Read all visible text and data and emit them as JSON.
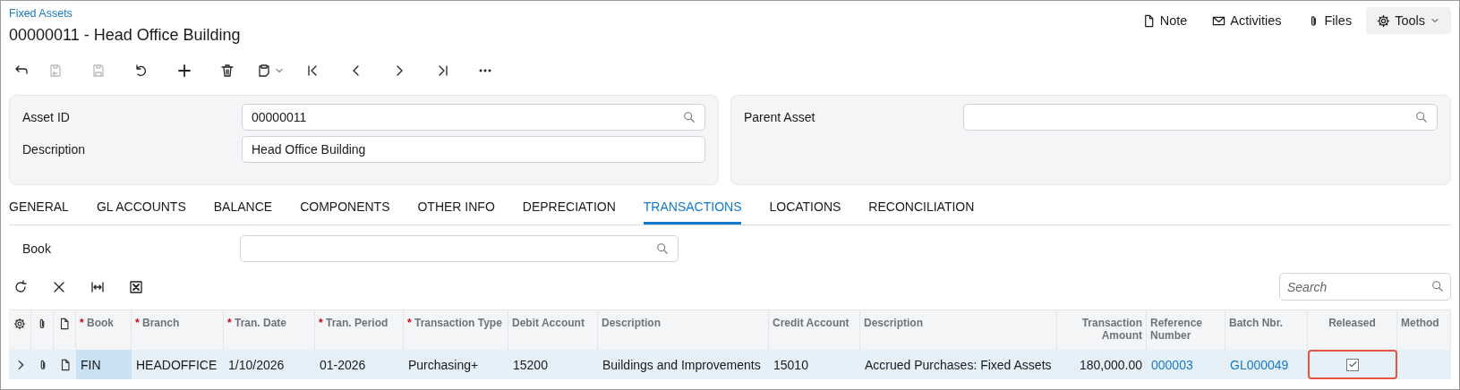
{
  "breadcrumb": "Fixed Assets",
  "title": "00000011 - Head Office Building",
  "header_actions": [
    {
      "kind": "note",
      "label": "Note"
    },
    {
      "kind": "activities",
      "label": "Activities"
    },
    {
      "kind": "files",
      "label": "Files"
    },
    {
      "kind": "tools",
      "label": "Tools"
    }
  ],
  "toolbar": [
    {
      "kind": "back",
      "disabled": false
    },
    {
      "kind": "save-close",
      "disabled": true
    },
    {
      "kind": "save",
      "disabled": true
    },
    {
      "kind": "undo",
      "disabled": false
    },
    {
      "kind": "add",
      "disabled": false
    },
    {
      "kind": "delete",
      "disabled": false
    },
    {
      "kind": "clipboard",
      "disabled": false
    },
    {
      "kind": "first",
      "disabled": false
    },
    {
      "kind": "prev",
      "disabled": false
    },
    {
      "kind": "next",
      "disabled": false
    },
    {
      "kind": "last",
      "disabled": false
    },
    {
      "kind": "more",
      "disabled": false
    }
  ],
  "form_left": [
    {
      "label": "Asset ID",
      "value": "00000011",
      "kind": "lookup"
    },
    {
      "label": "Description",
      "value": "Head Office Building",
      "kind": "text"
    }
  ],
  "form_right": [
    {
      "label": "Parent Asset",
      "kind": "lookup"
    }
  ],
  "tabs": [
    {
      "label": "GENERAL",
      "selected": false
    },
    {
      "label": "GL ACCOUNTS",
      "selected": false
    },
    {
      "label": "BALANCE",
      "selected": false
    },
    {
      "label": "COMPONENTS",
      "selected": false
    },
    {
      "label": "OTHER INFO",
      "selected": false
    },
    {
      "label": "DEPRECIATION",
      "selected": false
    },
    {
      "label": "TRANSACTIONS",
      "selected": true
    },
    {
      "label": "LOCATIONS",
      "selected": false
    },
    {
      "label": "RECONCILIATION",
      "selected": false
    }
  ],
  "book_filter": {
    "label": "Book"
  },
  "grid_toolbar": [
    {
      "kind": "refresh"
    },
    {
      "kind": "cancel"
    },
    {
      "kind": "fit"
    },
    {
      "kind": "excel"
    }
  ],
  "grid_search": {
    "placeholder": "Search"
  },
  "table": {
    "required_mark": "*",
    "columns": [
      {
        "label": "Book",
        "required": true,
        "kind": "text"
      },
      {
        "label": "Branch",
        "required": true,
        "kind": "text"
      },
      {
        "label": "Tran. Date",
        "required": true,
        "kind": "text"
      },
      {
        "label": "Tran. Period",
        "required": true,
        "kind": "text"
      },
      {
        "label": "Transaction Type",
        "required": true,
        "kind": "text"
      },
      {
        "label": "Debit Account",
        "required": false,
        "kind": "text"
      },
      {
        "label": "Description",
        "required": false,
        "kind": "text"
      },
      {
        "label": "Credit Account",
        "required": false,
        "kind": "text"
      },
      {
        "label": "Description",
        "required": false,
        "kind": "text"
      },
      {
        "label": "Transaction Amount",
        "required": false,
        "kind": "amount"
      },
      {
        "label": "Reference Number",
        "required": false,
        "kind": "link"
      },
      {
        "label": "Batch Nbr.",
        "required": false,
        "kind": "link"
      },
      {
        "label": "Released",
        "required": false,
        "kind": "checkbox"
      },
      {
        "label": "Method",
        "required": false,
        "kind": "text"
      }
    ],
    "rows": [
      {
        "selected": true,
        "cells": [
          {
            "value": "FIN",
            "focused": true
          },
          {
            "value": "HEADOFFICE",
            "focused": false
          },
          {
            "value": "1/10/2026",
            "focused": false
          },
          {
            "value": "01-2026",
            "focused": false
          },
          {
            "value": "Purchasing+",
            "focused": false
          },
          {
            "value": "15200",
            "focused": false
          },
          {
            "value": "Buildings and Improvements",
            "focused": false
          },
          {
            "value": "15010",
            "focused": false
          },
          {
            "value": "Accrued Purchases: Fixed Assets",
            "focused": false
          },
          {
            "value": "180,000.00",
            "focused": false
          },
          {
            "value": "000003",
            "focused": false
          },
          {
            "value": "GL000049",
            "focused": false
          },
          {
            "checked": true,
            "focused": false,
            "highlighted": true
          }
        ]
      }
    ]
  }
}
